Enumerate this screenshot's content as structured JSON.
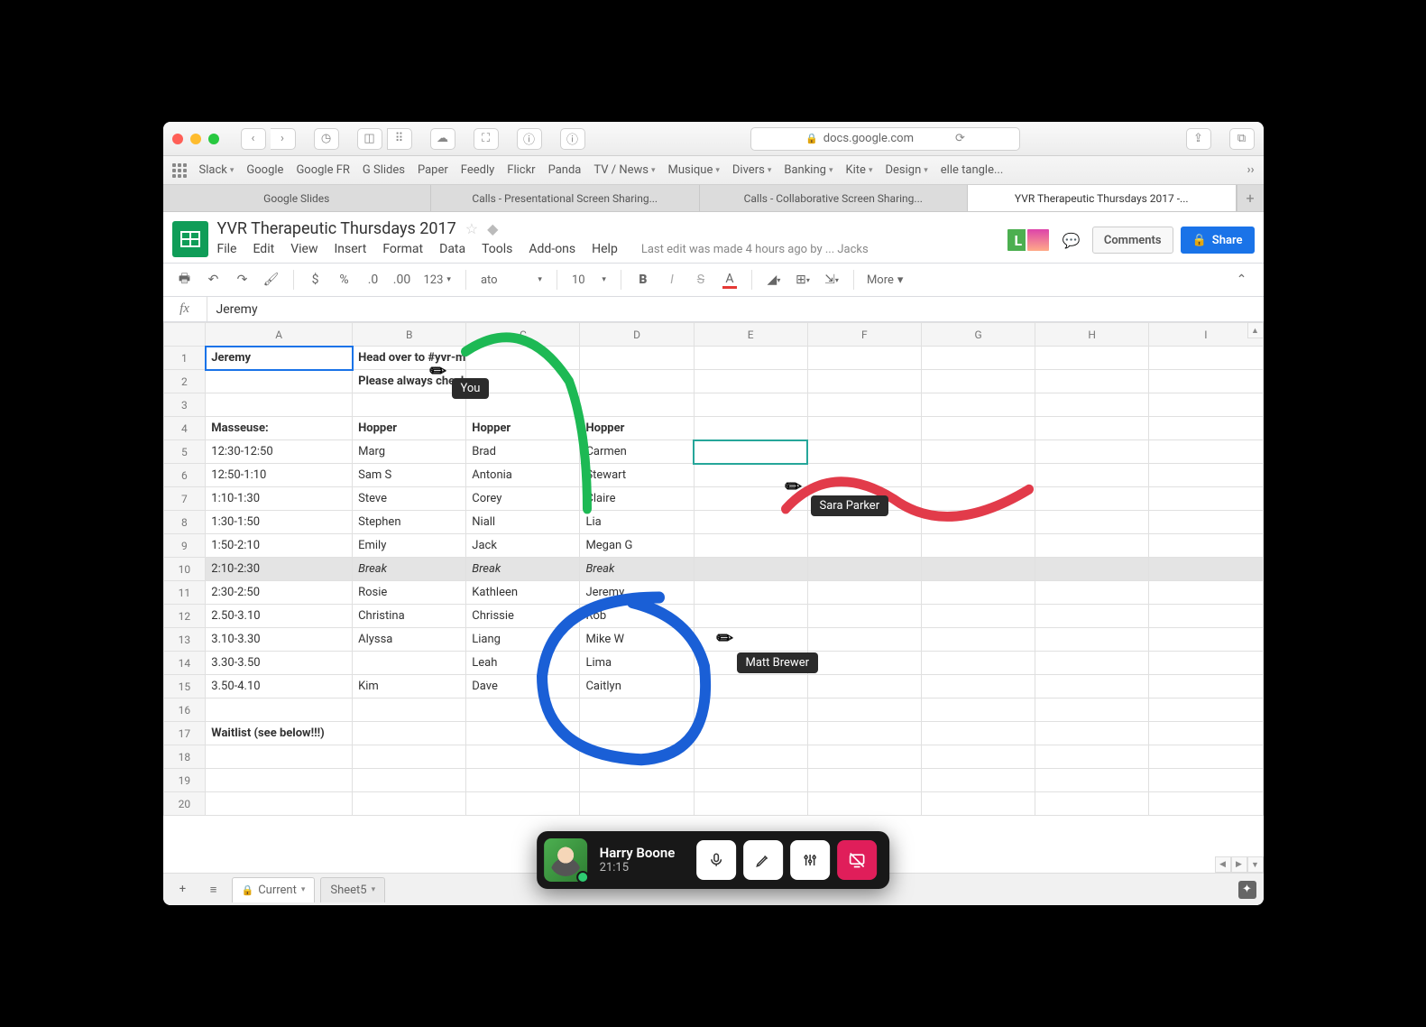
{
  "browser": {
    "url_host": "docs.google.com",
    "bookmarks": [
      "Slack",
      "Google",
      "Google FR",
      "G Slides",
      "Paper",
      "Feedly",
      "Flickr",
      "Panda",
      "TV / News",
      "Musique",
      "Divers",
      "Banking",
      "Kite",
      "Design",
      "elle tangle..."
    ],
    "bookmark_has_menu": [
      true,
      false,
      false,
      false,
      false,
      false,
      false,
      false,
      true,
      true,
      true,
      true,
      true,
      true,
      false
    ],
    "tabs": [
      {
        "label": "Google Slides"
      },
      {
        "label": "Calls - Presentational Screen Sharing..."
      },
      {
        "label": "Calls - Collaborative Screen Sharing..."
      },
      {
        "label": "YVR Therapeutic Thursdays 2017 -..."
      }
    ],
    "active_tab_index": 3
  },
  "doc": {
    "title": "YVR Therapeutic Thursdays 2017",
    "menus": [
      "File",
      "Edit",
      "View",
      "Insert",
      "Format",
      "Data",
      "Tools",
      "Add-ons",
      "Help"
    ],
    "last_edit": "Last edit was made 4 hours ago by",
    "last_edit_name": "Jacks",
    "comments_btn": "Comments",
    "share_btn": "Share",
    "presence_initial": "L"
  },
  "toolbar": {
    "currency": "$",
    "percent": "%",
    "dec_dec": ".0",
    "dec_inc": ".00",
    "format_pick": "123",
    "font": "ato",
    "font_size": "10",
    "more": "More"
  },
  "formula": {
    "fx": "fx",
    "value": "Jeremy"
  },
  "columns": [
    "A",
    "B",
    "C",
    "D",
    "E",
    "F",
    "G",
    "H",
    "I"
  ],
  "rows": [
    {
      "n": 1,
      "cells": [
        "Jeremy",
        "Head over to #yvr-massage to post about changing massage times or freeing up your spot",
        "",
        "",
        "",
        "",
        "",
        "",
        ""
      ],
      "bold": [
        0,
        1
      ],
      "overflow": [
        1
      ],
      "selected": 0
    },
    {
      "n": 2,
      "cells": [
        "",
        "Please always check the waitlist first",
        "",
        "",
        "",
        "",
        "",
        "",
        ""
      ],
      "bold": [
        1
      ],
      "overflow": [
        1
      ]
    },
    {
      "n": 3,
      "cells": [
        "",
        "",
        "",
        "",
        "",
        "",
        "",
        "",
        ""
      ]
    },
    {
      "n": 4,
      "cells": [
        "Masseuse:",
        "Hopper",
        "Hopper",
        "Hopper",
        "",
        "",
        "",
        "",
        ""
      ],
      "bold": [
        0,
        1,
        2,
        3
      ]
    },
    {
      "n": 5,
      "cells": [
        "12:30-12:50",
        "Marg",
        "Brad",
        "Carmen",
        "",
        "",
        "",
        "",
        ""
      ],
      "right": [
        0
      ],
      "active_other": 4
    },
    {
      "n": 6,
      "cells": [
        "12:50-1:10",
        "Sam S",
        "Antonia",
        "Stewart",
        "",
        "",
        "",
        "",
        ""
      ],
      "right": [
        0
      ]
    },
    {
      "n": 7,
      "cells": [
        "1:10-1:30",
        "Steve",
        "Corey",
        "Claire",
        "",
        "",
        "",
        "",
        ""
      ],
      "right": [
        0
      ]
    },
    {
      "n": 8,
      "cells": [
        "1:30-1:50",
        "Stephen",
        "Niall",
        "Lia",
        "",
        "",
        "",
        "",
        ""
      ],
      "right": [
        0
      ]
    },
    {
      "n": 9,
      "cells": [
        "1:50-2:10",
        "Emily",
        "Jack",
        "Megan G",
        "",
        "",
        "",
        "",
        ""
      ],
      "right": [
        0
      ]
    },
    {
      "n": 10,
      "cells": [
        "2:10-2:30",
        "Break",
        "Break",
        "Break",
        "",
        "",
        "",
        "",
        ""
      ],
      "right": [
        0
      ],
      "italic": [
        1,
        2,
        3
      ],
      "break": true
    },
    {
      "n": 11,
      "cells": [
        "2:30-2:50",
        "Rosie",
        "Kathleen",
        "Jeremy",
        "",
        "",
        "",
        "",
        ""
      ],
      "right": [
        0
      ]
    },
    {
      "n": 12,
      "cells": [
        "2.50-3.10",
        "Christina",
        "Chrissie",
        "Rob",
        "",
        "",
        "",
        "",
        ""
      ],
      "right": [
        0
      ]
    },
    {
      "n": 13,
      "cells": [
        "3.10-3.30",
        "Alyssa",
        "Liang",
        "Mike W",
        "",
        "",
        "",
        "",
        ""
      ],
      "right": [
        0
      ]
    },
    {
      "n": 14,
      "cells": [
        "3.30-3.50",
        "",
        "Leah",
        "Lima",
        "",
        "",
        "",
        "",
        ""
      ],
      "right": [
        0
      ]
    },
    {
      "n": 15,
      "cells": [
        "3.50-4.10",
        "Kim",
        "Dave",
        "Caitlyn",
        "",
        "",
        "",
        "",
        ""
      ],
      "right": [
        0
      ]
    },
    {
      "n": 16,
      "cells": [
        "",
        "",
        "",
        "",
        "",
        "",
        "",
        "",
        ""
      ]
    },
    {
      "n": 17,
      "cells": [
        "Waitlist (see below!!!)",
        "",
        "",
        "",
        "",
        "",
        "",
        "",
        ""
      ],
      "bold": [
        0
      ],
      "overflow": [
        0
      ]
    },
    {
      "n": 18,
      "cells": [
        "",
        "",
        "",
        "",
        "",
        "",
        "",
        "",
        ""
      ]
    },
    {
      "n": 19,
      "cells": [
        "",
        "",
        "",
        "",
        "",
        "",
        "",
        "",
        ""
      ]
    },
    {
      "n": 20,
      "cells": [
        "",
        "",
        "",
        "",
        "",
        "",
        "",
        "",
        ""
      ]
    }
  ],
  "sheet_tabs": {
    "current": "Current",
    "other": "Sheet5"
  },
  "annotations": {
    "you": "You",
    "sara": "Sara Parker",
    "matt": "Matt Brewer",
    "colors": {
      "you": "#1db954",
      "sara": "#e23b4a",
      "matt": "#1a5fd6"
    }
  },
  "call": {
    "name": "Harry Boone",
    "time": "21:15"
  }
}
